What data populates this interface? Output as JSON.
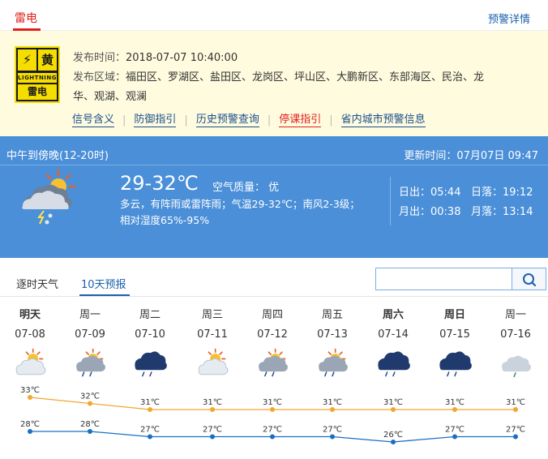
{
  "warning": {
    "tab_label": "雷电",
    "detail_link": "预警详情",
    "icon": {
      "name": "lightning-yellow-warning-icon",
      "symbol": "⚡",
      "level_char": "黄",
      "english": "LIGHTNING",
      "type_label": "雷电",
      "color": "#f5dd00"
    },
    "publish_time_label": "发布时间：",
    "publish_time": "2018-07-07 10:40:00",
    "area_label": "发布区域：",
    "area_line1": "福田区、罗湖区、盐田区、龙岗区、坪山区、大鹏新区、东部海区、民治、龙",
    "area_line2": "华、观湖、观澜",
    "links": [
      "信号含义",
      "防御指引",
      "历史预警查询",
      "停课指引",
      "省内城市预警信息"
    ]
  },
  "now": {
    "period": "中午到傍晚(12-20时)",
    "update_time": "更新时间：07月07日 09:47",
    "icon": "partly-cloudy-thunderstorm-icon",
    "temp": "29-32℃",
    "aqi": "空气质量： 优",
    "desc_line1": "多云，有阵雨或雷阵雨；气温29-32℃；南风2-3级；",
    "desc_line2": "相对湿度65%-95%",
    "sunrise": "日出：05:44",
    "sunset": "日落：19:12",
    "moonrise": "月出：00:38",
    "moonset": "月落：13:14",
    "bg_color": "#4a8fd8"
  },
  "tabs": {
    "hourly": "逐时天气",
    "ten_day": "10天预报"
  },
  "search": {
    "value": "",
    "placeholder": ""
  },
  "forecast": [
    {
      "day": "明天",
      "date": "07-08",
      "icon": "sunny-cloudy-icon",
      "high": "33℃",
      "low": "28℃",
      "bold": true
    },
    {
      "day": "周一",
      "date": "07-09",
      "icon": "sun-cloud-rain-icon",
      "high": "32℃",
      "low": "28℃",
      "bold": false
    },
    {
      "day": "周二",
      "date": "07-10",
      "icon": "dark-cloud-rain-icon",
      "high": "31℃",
      "low": "27℃",
      "bold": false
    },
    {
      "day": "周三",
      "date": "07-11",
      "icon": "sunny-cloudy-icon",
      "high": "31℃",
      "low": "27℃",
      "bold": false
    },
    {
      "day": "周四",
      "date": "07-12",
      "icon": "sun-cloud-rain-icon",
      "high": "31℃",
      "low": "27℃",
      "bold": false
    },
    {
      "day": "周五",
      "date": "07-13",
      "icon": "sun-cloud-rain-icon",
      "high": "31℃",
      "low": "27℃",
      "bold": false
    },
    {
      "day": "周六",
      "date": "07-14",
      "icon": "dark-cloud-rain-icon",
      "high": "31℃",
      "low": "26℃",
      "bold": true
    },
    {
      "day": "周日",
      "date": "07-15",
      "icon": "dark-cloud-rain-icon",
      "high": "31℃",
      "low": "27℃",
      "bold": true
    },
    {
      "day": "周一",
      "date": "07-16",
      "icon": "cloud-light-rain-icon",
      "high": "31℃",
      "low": "27℃",
      "bold": false
    }
  ],
  "chart_data": {
    "type": "line",
    "categories": [
      "07-08",
      "07-09",
      "07-10",
      "07-11",
      "07-12",
      "07-13",
      "07-14",
      "07-15",
      "07-16"
    ],
    "series": [
      {
        "values": [
          33,
          32,
          31,
          31,
          31,
          31,
          31,
          31,
          31
        ],
        "color": "#f0a830"
      },
      {
        "values": [
          28,
          28,
          27,
          27,
          27,
          27,
          26,
          27,
          27
        ],
        "color": "#1a6fc4"
      }
    ],
    "unit": "℃"
  }
}
